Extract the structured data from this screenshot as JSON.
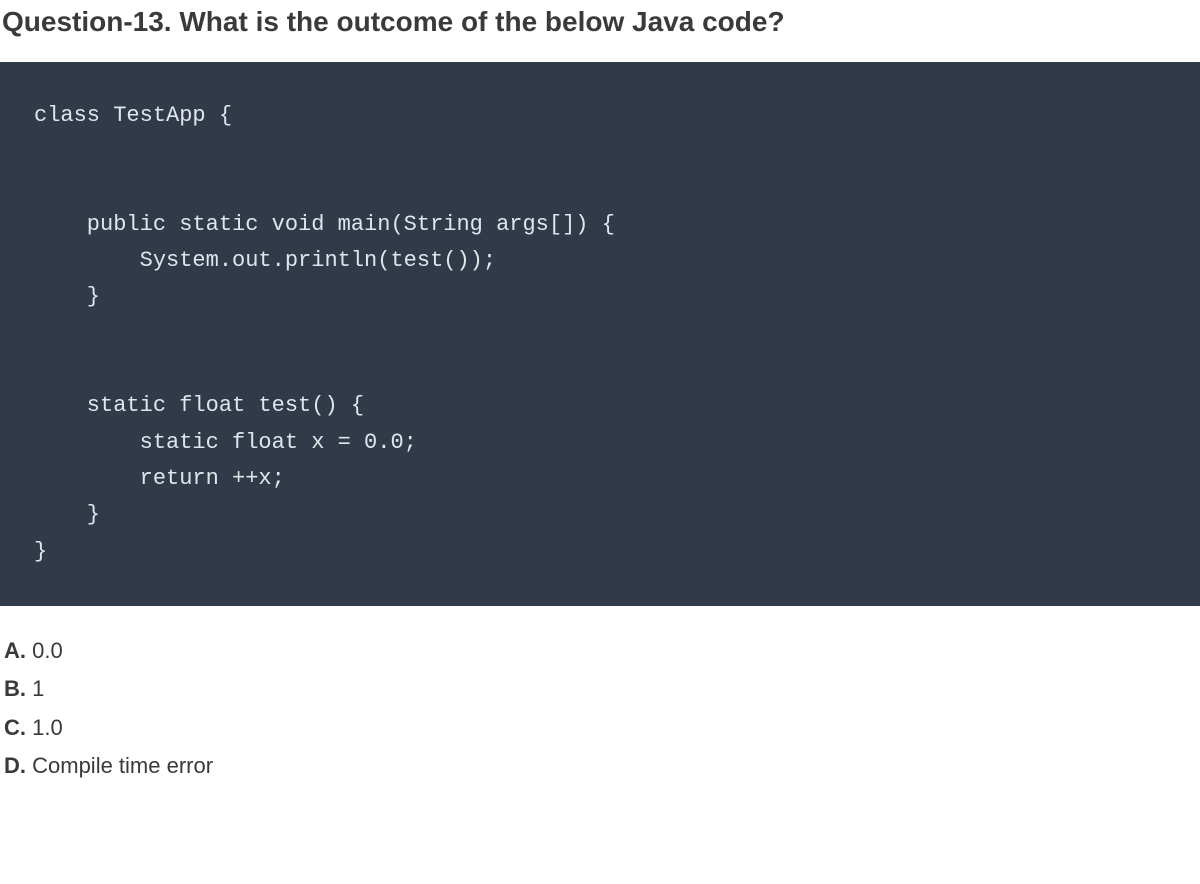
{
  "question": {
    "title": "Question-13. What is the outcome of the below Java code?"
  },
  "code": "class TestApp {\n\n\n    public static void main(String args[]) {\n        System.out.println(test());\n    }\n\n\n    static float test() {\n        static float x = 0.0;\n        return ++x;\n    }\n}",
  "options": [
    {
      "label": "A.",
      "text": "0.0"
    },
    {
      "label": "B.",
      "text": "1"
    },
    {
      "label": "C.",
      "text": "1.0"
    },
    {
      "label": "D.",
      "text": "Compile time error"
    }
  ]
}
